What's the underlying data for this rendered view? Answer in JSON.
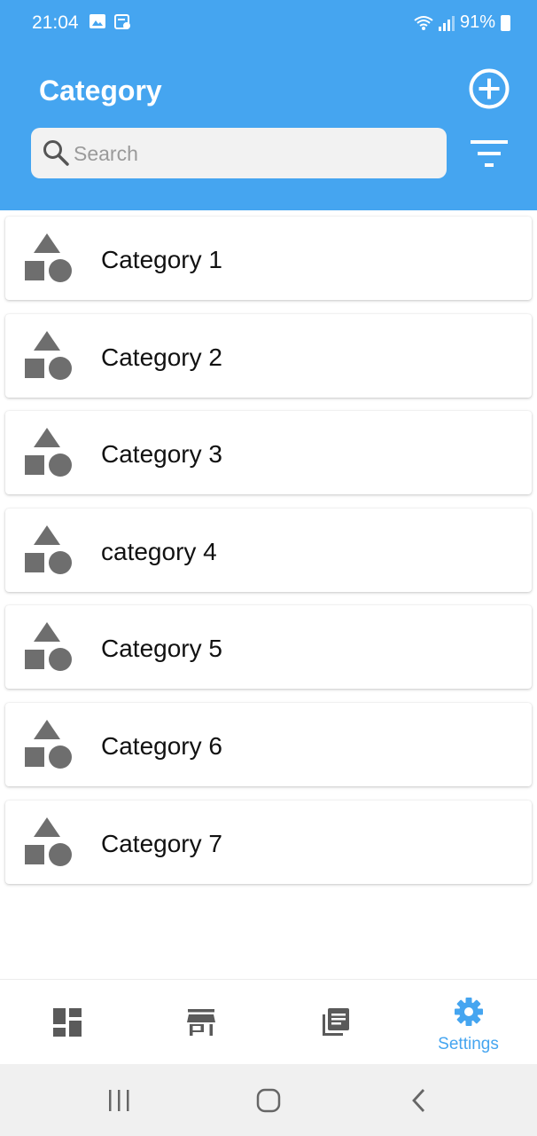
{
  "status_bar": {
    "time": "21:04",
    "battery": "91%",
    "icons": [
      "image-icon",
      "calendar-icon",
      "wifi-icon",
      "signal-icon",
      "battery-icon"
    ]
  },
  "header": {
    "title": "Category",
    "search_placeholder": "Search",
    "search_value": "",
    "add_icon": "add-circle-icon",
    "filter_icon": "filter-icon"
  },
  "categories": [
    {
      "label": "Category 1",
      "icon": "shapes-icon"
    },
    {
      "label": "Category 2",
      "icon": "shapes-icon"
    },
    {
      "label": "Category 3",
      "icon": "shapes-icon"
    },
    {
      "label": "category 4",
      "icon": "shapes-icon"
    },
    {
      "label": "Category 5",
      "icon": "shapes-icon"
    },
    {
      "label": "Category 6",
      "icon": "shapes-icon"
    },
    {
      "label": "Category 7",
      "icon": "shapes-icon"
    }
  ],
  "bottom_nav": {
    "items": [
      {
        "icon": "dashboard-icon",
        "label": "",
        "active": false
      },
      {
        "icon": "store-icon",
        "label": "",
        "active": false
      },
      {
        "icon": "library-books-icon",
        "label": "",
        "active": false
      },
      {
        "icon": "settings-icon",
        "label": "Settings",
        "active": true
      }
    ]
  },
  "colors": {
    "primary": "#45a5f0",
    "icon_gray": "#6e6e6e",
    "nav_gray": "#5a5a5a",
    "system_nav_bg": "#f0f0f0"
  }
}
